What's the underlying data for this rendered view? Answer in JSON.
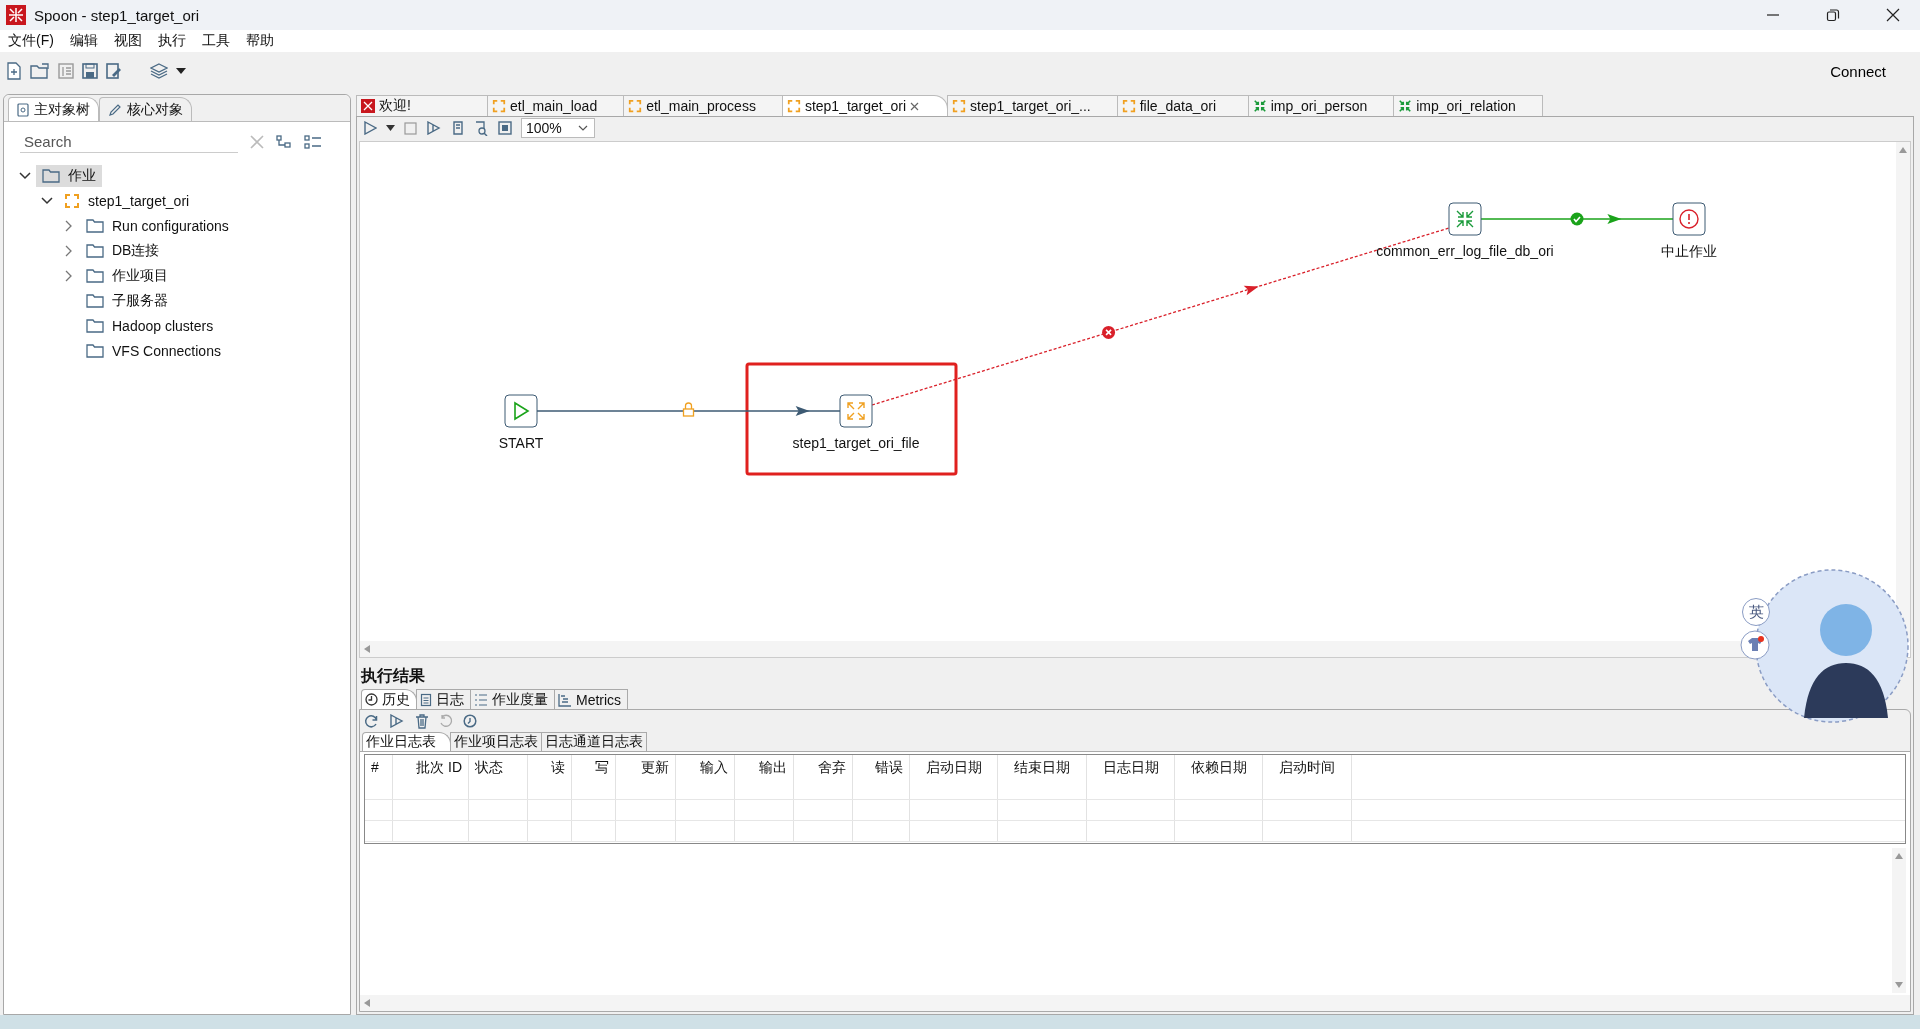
{
  "window": {
    "title": "Spoon - step1_target_ori"
  },
  "menu": [
    {
      "label": "文件(F)"
    },
    {
      "label": "编辑"
    },
    {
      "label": "视图"
    },
    {
      "label": "执行"
    },
    {
      "label": "工具"
    },
    {
      "label": "帮助"
    }
  ],
  "toolbar": {
    "connect": "Connect"
  },
  "sidebar": {
    "tabs": [
      {
        "label": "主对象树",
        "selected": true
      },
      {
        "label": "核心对象",
        "selected": false
      }
    ],
    "search": {
      "placeholder": "Search"
    },
    "tree": [
      {
        "label": "作业",
        "kind": "folder",
        "expandable": true,
        "expanded": true,
        "selected": true,
        "children": [
          {
            "label": "step1_target_ori",
            "kind": "job",
            "expandable": true,
            "expanded": true,
            "selected": false,
            "children": [
              {
                "label": "Run configurations",
                "kind": "folder",
                "expandable": true,
                "expanded": false,
                "selected": false
              },
              {
                "label": "DB连接",
                "kind": "folder",
                "expandable": true,
                "expanded": false,
                "selected": false
              },
              {
                "label": "作业项目",
                "kind": "folder",
                "expandable": true,
                "expanded": false,
                "selected": false
              },
              {
                "label": "子服务器",
                "kind": "folder",
                "expandable": false,
                "selected": false
              },
              {
                "label": "Hadoop clusters",
                "kind": "folder",
                "expandable": false,
                "selected": false
              },
              {
                "label": "VFS Connections",
                "kind": "folder",
                "expandable": false,
                "selected": false
              }
            ]
          }
        ]
      }
    ]
  },
  "editor_tabs": [
    {
      "label": "欢迎!",
      "kind": "welcome",
      "selected": false
    },
    {
      "label": "etl_main_load",
      "kind": "job",
      "selected": false
    },
    {
      "label": "etl_main_process",
      "kind": "job",
      "selected": false
    },
    {
      "label": "step1_target_ori",
      "kind": "job",
      "selected": true
    },
    {
      "label": "step1_target_ori_...",
      "kind": "job",
      "selected": false
    },
    {
      "label": "file_data_ori",
      "kind": "job",
      "selected": false
    },
    {
      "label": "imp_ori_person",
      "kind": "transform",
      "selected": false
    },
    {
      "label": "imp_ori_relation",
      "kind": "transform",
      "selected": false
    }
  ],
  "zoom": "100%",
  "canvas": {
    "nodes": [
      {
        "label": "START",
        "kind": "start"
      },
      {
        "label": "step1_target_ori_file",
        "kind": "job",
        "highlighted": true
      },
      {
        "label": "common_err_log_file_db_ori",
        "kind": "transform"
      },
      {
        "label": "中止作业",
        "kind": "abort"
      }
    ],
    "hops": [
      {
        "kind": "unconditional"
      },
      {
        "kind": "error"
      },
      {
        "kind": "success"
      }
    ]
  },
  "results": {
    "title": "执行结果",
    "tabs": [
      {
        "label": "历史",
        "kind": "history",
        "selected": true
      },
      {
        "label": "日志",
        "kind": "log",
        "selected": false
      },
      {
        "label": "作业度量",
        "kind": "metrics",
        "selected": false
      },
      {
        "label": "Metrics",
        "kind": "chart",
        "selected": false
      }
    ],
    "sub_tabs": [
      {
        "label": "作业日志表",
        "selected": true
      },
      {
        "label": "作业项日志表",
        "selected": false
      },
      {
        "label": "日志通道日志表",
        "selected": false
      }
    ],
    "columns": [
      "#",
      "批次 ID",
      "状态",
      "读",
      "写",
      "更新",
      "输入",
      "输出",
      "舍弃",
      "错误",
      "启动日期",
      "结束日期",
      "日志日期",
      "依赖日期",
      "启动时间"
    ]
  },
  "ime": {
    "label": "英"
  }
}
